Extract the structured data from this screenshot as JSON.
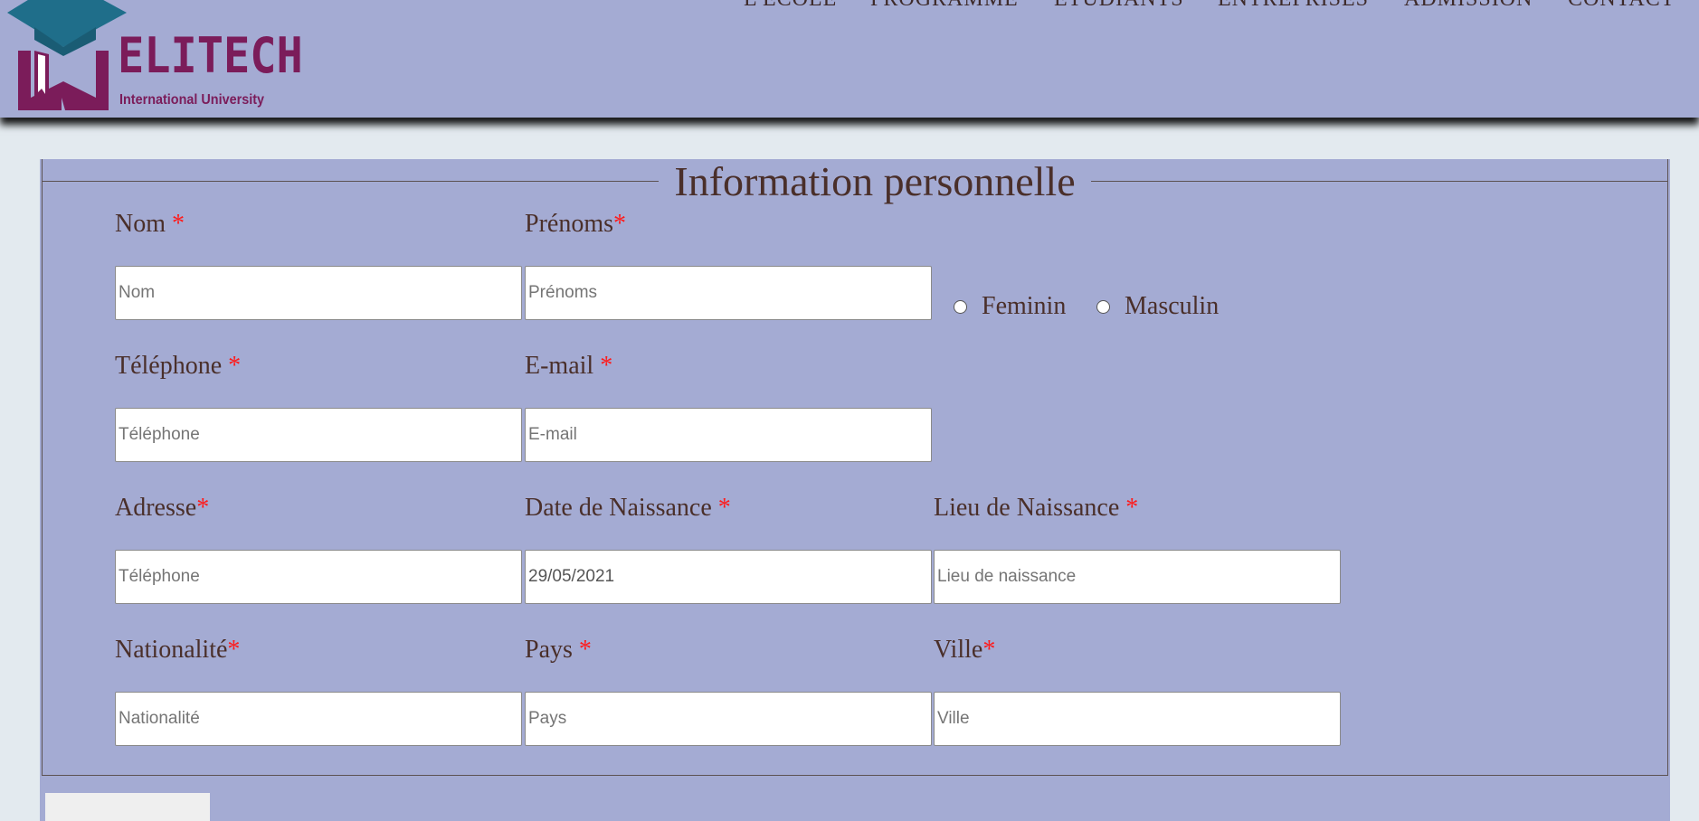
{
  "brand": {
    "name": "ELITECH",
    "subtitle": "International University",
    "colors": {
      "primary": "#7b1c5a",
      "cap": "#1f6e8a"
    }
  },
  "nav": {
    "items": [
      {
        "label": "L'ÉCOLE"
      },
      {
        "label": "PROGRAMME"
      },
      {
        "label": "ÉTUDIANTS"
      },
      {
        "label": "ENTREPRISES"
      },
      {
        "label": "ADMISSION"
      },
      {
        "label": "CONTACT"
      }
    ]
  },
  "form": {
    "legend": "Information personnelle",
    "required_mark": "*",
    "fields": {
      "nom": {
        "label": "Nom ",
        "placeholder": "Nom",
        "value": ""
      },
      "prenoms": {
        "label": "Prénoms",
        "placeholder": "Prénoms",
        "value": ""
      },
      "telephone": {
        "label": "Téléphone ",
        "placeholder": "Téléphone",
        "value": ""
      },
      "email": {
        "label": "E-mail ",
        "placeholder": "E-mail",
        "value": ""
      },
      "adresse": {
        "label": "Adresse",
        "placeholder": "Téléphone",
        "value": ""
      },
      "date_naissance": {
        "label": "Date de Naissance ",
        "placeholder": "",
        "value": "29/05/2021"
      },
      "lieu_naissance": {
        "label": "Lieu de Naissance ",
        "placeholder": "Lieu de naissance",
        "value": ""
      },
      "nationalite": {
        "label": "Nationalité",
        "placeholder": "Nationalité",
        "value": ""
      },
      "pays": {
        "label": "Pays ",
        "placeholder": "Pays",
        "value": ""
      },
      "ville": {
        "label": "Ville",
        "placeholder": "Ville",
        "value": ""
      }
    },
    "gender": {
      "options": [
        {
          "label": "Feminin",
          "selected": false
        },
        {
          "label": "Masculin",
          "selected": false
        }
      ]
    }
  },
  "colors": {
    "header_bg": "#a4abd3",
    "page_bg": "#e3eaef",
    "text": "#4a2f2a",
    "required": "#ff1a1a"
  }
}
